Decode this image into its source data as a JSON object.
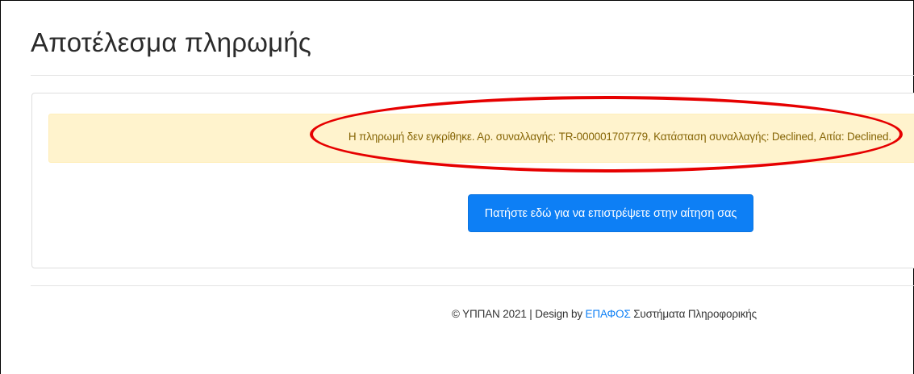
{
  "page": {
    "title": "Αποτέλεσμα πληρωμής"
  },
  "alert": {
    "message": "Η πληρωμή δεν εγκρίθηκε. Αρ. συναλλαγής: TR-000001707779, Κατάσταση συναλλαγής: Declined, Αιτία: Declined.",
    "type": "warning",
    "background_color": "#fff3cd",
    "text_color": "#856404",
    "highlight_color": "#e60000"
  },
  "actions": {
    "back_label": "Πατήστε εδώ για να επιστρέψετε στην αίτηση σας",
    "button_color": "#0d7ff5"
  },
  "footer": {
    "prefix": "© ΥΠΠΑΝ 2021 | Design by ",
    "company": "ΕΠΑΦΟΣ",
    "suffix": " Συστήματα Πληροφορικής"
  }
}
